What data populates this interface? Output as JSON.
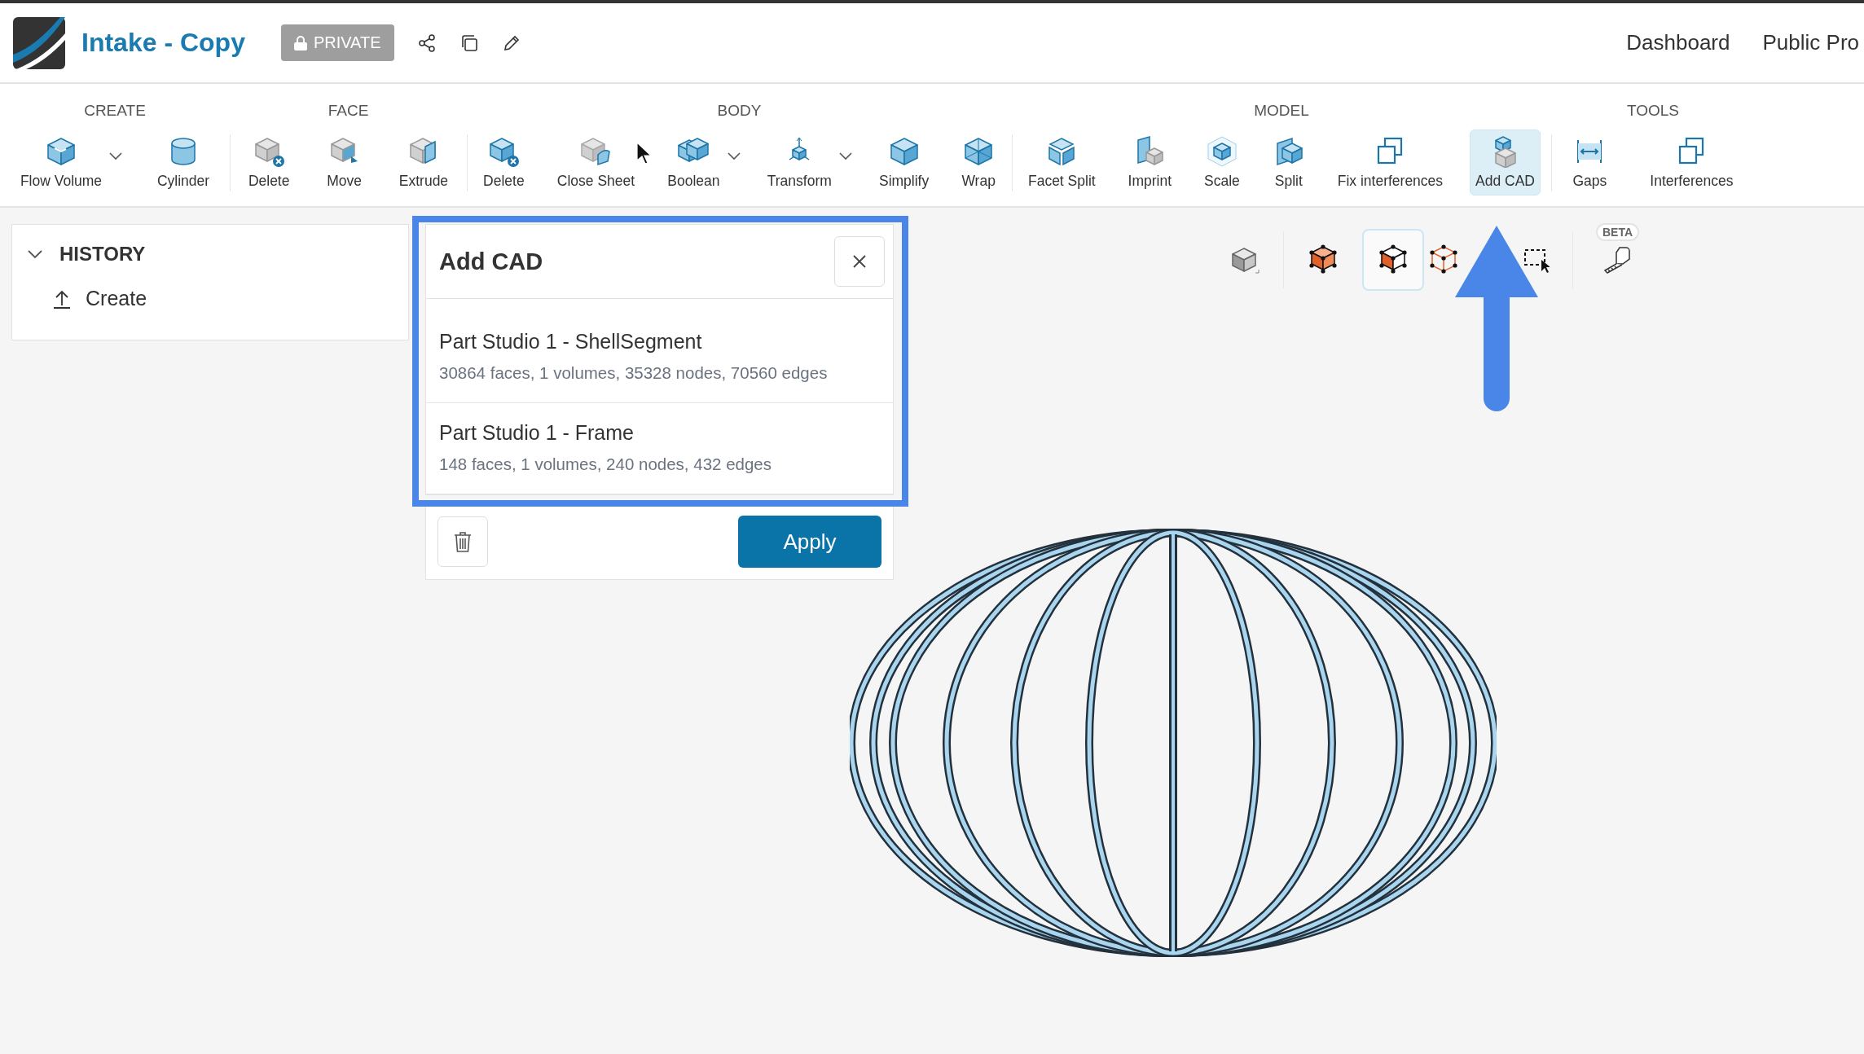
{
  "header": {
    "title": "Intake - Copy",
    "badge": "PRIVATE",
    "nav": [
      "Dashboard",
      "Public Pro"
    ]
  },
  "toolbar": {
    "groups": [
      {
        "label": "CREATE",
        "items": [
          {
            "kind": "flow-volume",
            "label": "Flow Volume",
            "dropdown": true,
            "selected": false
          },
          {
            "kind": "cylinder",
            "label": "Cylinder",
            "dropdown": false,
            "selected": false
          }
        ]
      },
      {
        "label": "FACE",
        "items": [
          {
            "kind": "face-delete",
            "label": "Delete",
            "dropdown": false,
            "selected": false
          },
          {
            "kind": "face-move",
            "label": "Move",
            "dropdown": false,
            "selected": false
          },
          {
            "kind": "face-extrude",
            "label": "Extrude",
            "dropdown": false,
            "selected": false
          }
        ]
      },
      {
        "label": "BODY",
        "items": [
          {
            "kind": "body-delete",
            "label": "Delete",
            "dropdown": false,
            "selected": false
          },
          {
            "kind": "close-sheet",
            "label": "Close Sheet",
            "dropdown": false,
            "selected": false
          },
          {
            "kind": "boolean",
            "label": "Boolean",
            "dropdown": true,
            "selected": false
          },
          {
            "kind": "transform",
            "label": "Transform",
            "dropdown": true,
            "selected": false
          },
          {
            "kind": "simplify",
            "label": "Simplify",
            "dropdown": false,
            "selected": false
          },
          {
            "kind": "wrap",
            "label": "Wrap",
            "dropdown": false,
            "selected": false
          }
        ]
      },
      {
        "label": "MODEL",
        "items": [
          {
            "kind": "facet-split",
            "label": "Facet Split",
            "dropdown": false,
            "selected": false
          },
          {
            "kind": "imprint",
            "label": "Imprint",
            "dropdown": false,
            "selected": false
          },
          {
            "kind": "scale",
            "label": "Scale",
            "dropdown": false,
            "selected": false
          },
          {
            "kind": "split",
            "label": "Split",
            "dropdown": false,
            "selected": false
          },
          {
            "kind": "squares",
            "label": "Fix interferences",
            "dropdown": false,
            "selected": false
          },
          {
            "kind": "add-cad",
            "label": "Add CAD",
            "dropdown": false,
            "selected": true
          }
        ]
      },
      {
        "label": "TOOLS",
        "items": [
          {
            "kind": "gaps",
            "label": "Gaps",
            "dropdown": false,
            "selected": false
          },
          {
            "kind": "squares",
            "label": "Interferences",
            "dropdown": false,
            "selected": false
          }
        ]
      }
    ]
  },
  "history": {
    "title": "HISTORY",
    "expanded": true,
    "items": [
      {
        "label": "Create"
      }
    ]
  },
  "add_cad": {
    "title": "Add CAD",
    "items": [
      {
        "name": "Part Studio 1 - ShellSegment",
        "details": "30864 faces, 1 volumes, 35328 nodes, 70560 edges"
      },
      {
        "name": "Part Studio 1 - Frame",
        "details": "148 faces, 1 volumes, 240 nodes, 432 edges"
      }
    ],
    "apply": "Apply"
  },
  "view_tools": [
    {
      "kind": "shaded",
      "selected": false
    },
    {
      "kind": "shaded-edges",
      "selected": false
    },
    {
      "kind": "face-edges",
      "selected": true
    },
    {
      "kind": "wireframe",
      "selected": false
    },
    {
      "kind": "box-select",
      "selected": false
    },
    {
      "kind": "measure",
      "selected": false,
      "badge": "BETA"
    }
  ],
  "annotations": {
    "highlight_frame": true,
    "arrow": true
  }
}
